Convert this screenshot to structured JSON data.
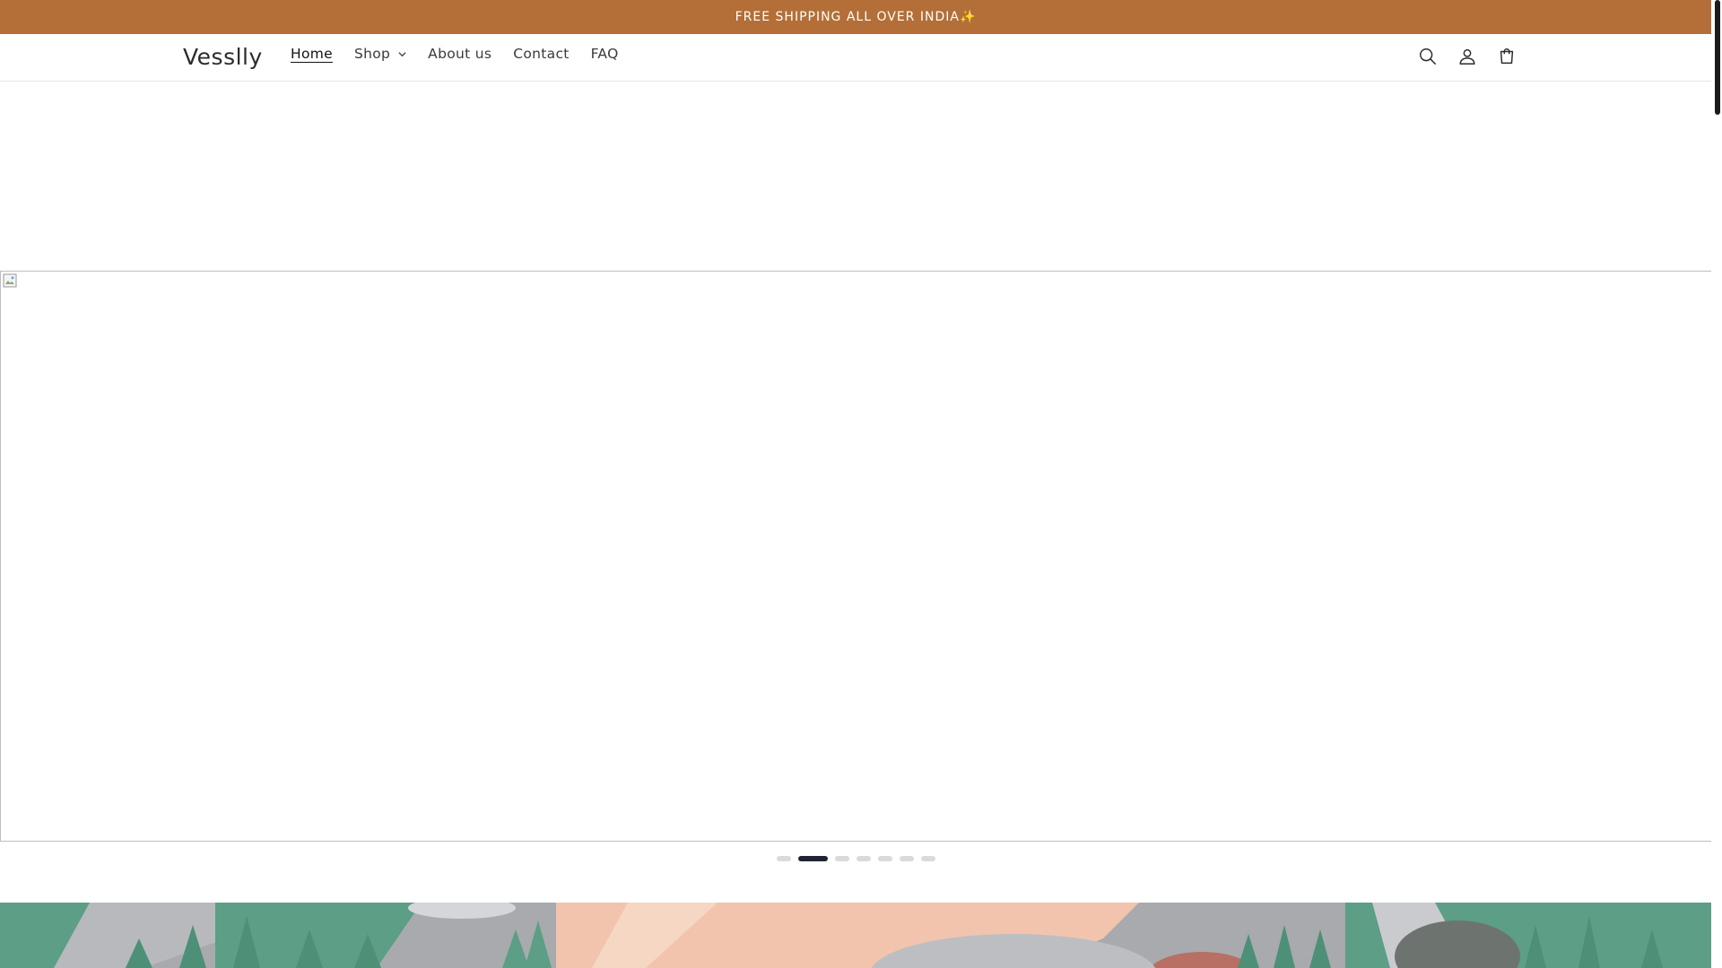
{
  "announcement": {
    "text": "FREE SHIPPING ALL OVER INDIA✨"
  },
  "header": {
    "logo": "Vesslly",
    "nav": [
      {
        "label": "Home",
        "active": true
      },
      {
        "label": "Shop",
        "has_dropdown": true
      },
      {
        "label": "About us"
      },
      {
        "label": "Contact"
      },
      {
        "label": "FAQ"
      }
    ],
    "icons": [
      "search-icon",
      "account-icon",
      "cart-icon"
    ]
  },
  "slideshow": {
    "slide_count": 7,
    "active_slide_index": 1
  },
  "colors": {
    "announcement_bg": "#b36f37",
    "active_dot": "#1f2433",
    "inactive_dot": "#d9dadb",
    "banner_green": "#5c9e86",
    "banner_peach": "#f2c4ad",
    "banner_grey": "#a8aaad"
  }
}
